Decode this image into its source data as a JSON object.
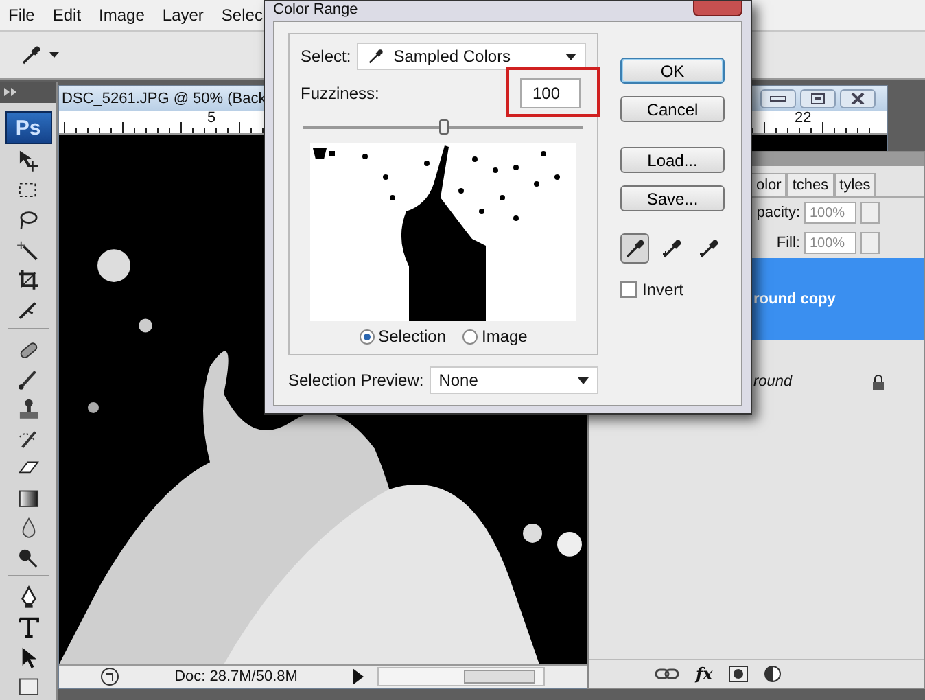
{
  "menu_bar": {
    "items": [
      "File",
      "Edit",
      "Image",
      "Layer",
      "Selec"
    ]
  },
  "tools_panel": {
    "logo": "Ps"
  },
  "document": {
    "title": "DSC_5261.JPG @ 50% (Back",
    "ruler_labels": [
      "5",
      "22"
    ],
    "status": "Doc: 28.7M/50.8M"
  },
  "layers_panel": {
    "tabs": [
      "olor",
      "tches",
      "tyles"
    ],
    "opacity_label": "pacity:",
    "opacity": "100%",
    "fill_label": "Fill:",
    "fill": "100%",
    "effects_button": "fx",
    "layers": [
      {
        "name": "round copy",
        "selected": true,
        "locked": false
      },
      {
        "name": "round",
        "selected": false,
        "locked": true
      }
    ]
  },
  "dialog": {
    "title": "Color Range",
    "select_label": "Select:",
    "select_value": "Sampled Colors",
    "fuzziness_label": "Fuzziness:",
    "fuzziness": "100",
    "fuzziness_highlighted": true,
    "fuzziness_slider": {
      "level": 0.5
    },
    "view_options": [
      {
        "label": "Selection",
        "selected": true
      },
      {
        "label": "Image",
        "selected": false
      }
    ],
    "preview_label": "Selection Preview:",
    "preview_value": "None",
    "buttons": [
      {
        "label": "OK",
        "default": true
      },
      {
        "label": "Cancel",
        "default": false
      },
      {
        "label": "Load...",
        "default": false
      },
      {
        "label": "Save...",
        "default": false
      }
    ],
    "eyedroppers": [
      {
        "kind": "sample",
        "selected": true
      },
      {
        "kind": "add",
        "selected": false
      },
      {
        "kind": "subtract",
        "selected": false
      }
    ],
    "invert": {
      "label": "Invert",
      "checked": false
    }
  }
}
